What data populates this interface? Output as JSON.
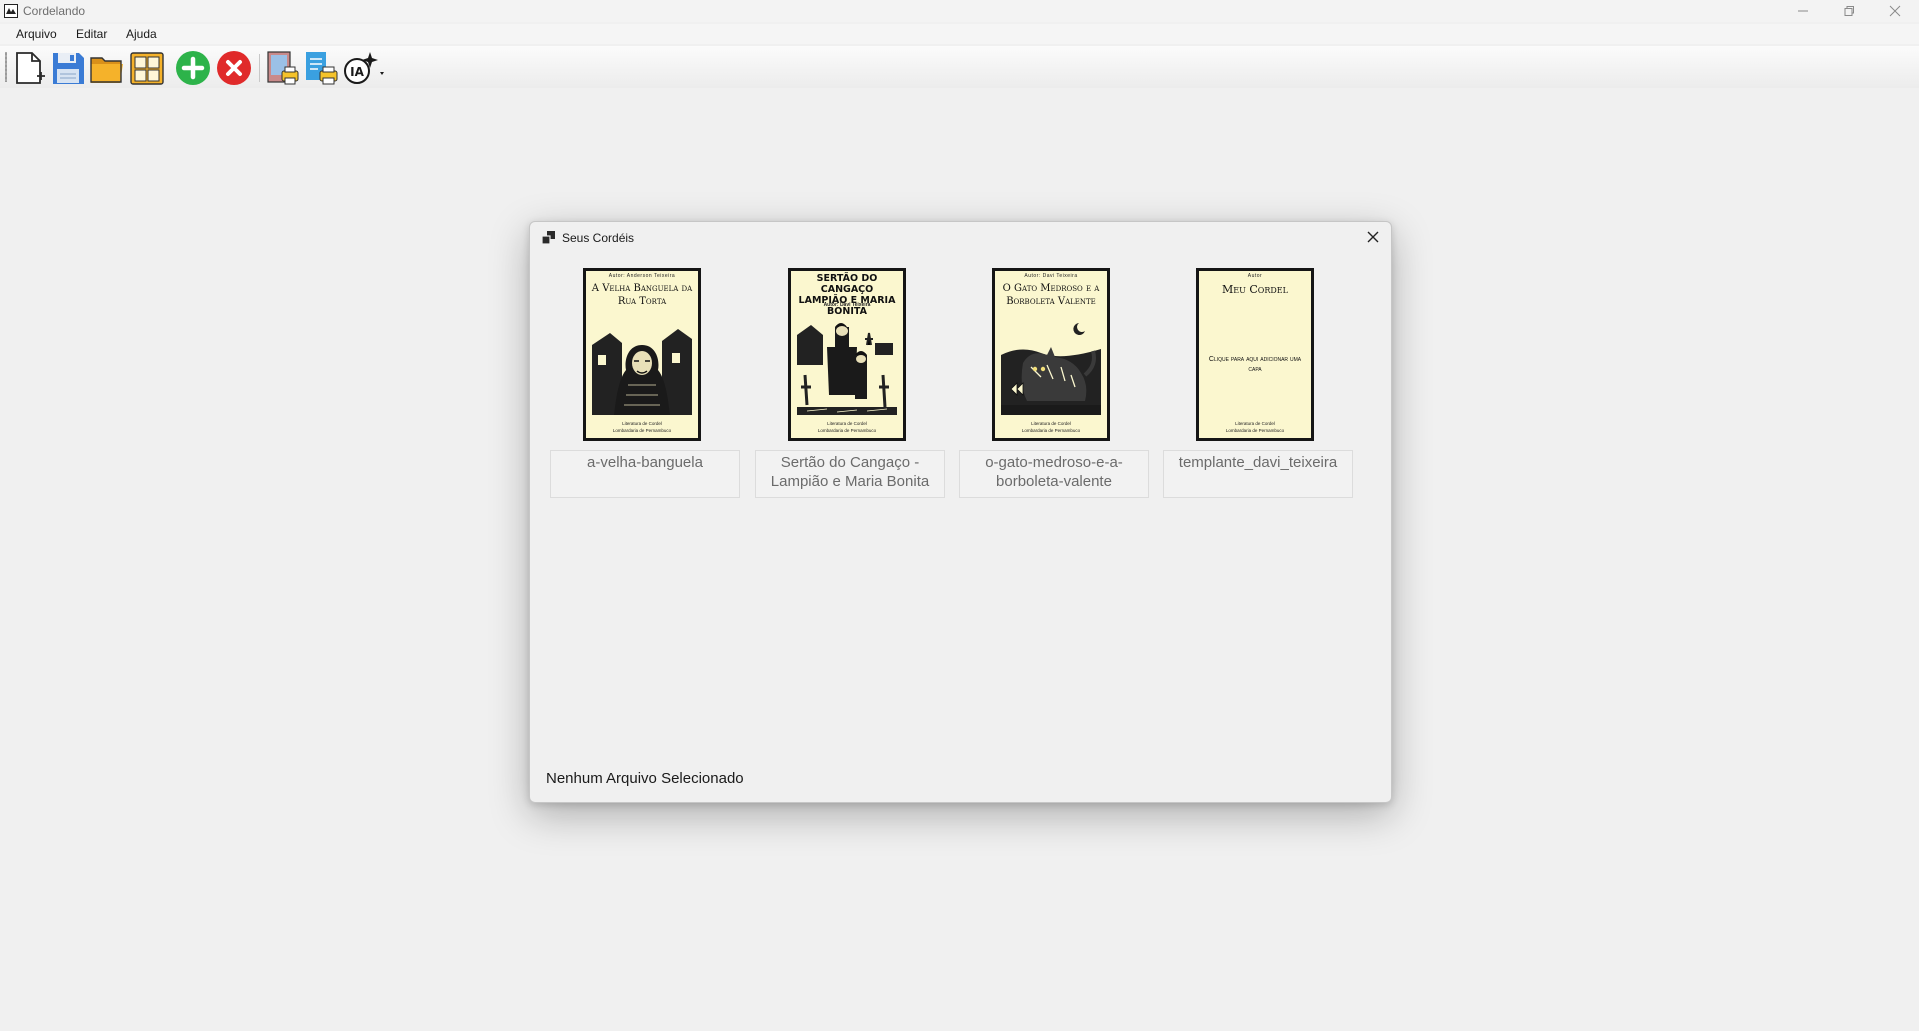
{
  "window": {
    "title": "Cordelando"
  },
  "menu": {
    "items": [
      "Arquivo",
      "Editar",
      "Ajuda"
    ]
  },
  "toolbar": {
    "buttons": [
      {
        "icon": "new-file-icon"
      },
      {
        "icon": "save-icon"
      },
      {
        "icon": "open-folder-icon"
      },
      {
        "icon": "library-icon"
      },
      {
        "icon": "add-icon"
      },
      {
        "icon": "remove-icon"
      },
      {
        "icon": "print-book-icon"
      },
      {
        "icon": "print-document-icon"
      },
      {
        "icon": "ai-assistant-icon"
      }
    ]
  },
  "dialog": {
    "title": "Seus Cordéis",
    "status": "Nenhum Arquivo Selecionado",
    "cordeis": [
      {
        "label": "a-velha-banguela",
        "cover_author": "Autor: Anderson Teixeira",
        "cover_title": "A Velha Banguela da Rua Torta",
        "cover_footer": [
          "Literatura de Cordel",
          "Lombardaria de Pernambuco"
        ]
      },
      {
        "label": "Sertão do Cangaço - Lampião e Maria Bonita",
        "cover_title": "SERTÃO DO CANGAÇO LAMPIÃO E MARIA BONITA",
        "cover_author": "Autor: Davi Teixeira",
        "cover_footer": [
          "Literatura de Cordel",
          "Lombardaria de Pernambuco"
        ]
      },
      {
        "label": "o-gato-medroso-e-a-borboleta-valente",
        "cover_author": "Autor: Davi Teixeira",
        "cover_title": "O Gato Medroso e a Borboleta Valente",
        "cover_footer": [
          "Literatura de Cordel",
          "Lombardaria de Pernambuco"
        ]
      },
      {
        "label": "templante_davi_teixeira",
        "cover_author": "Autor",
        "cover_title": "Meu Cordel",
        "cover_cta": "Clique para aqui adicionar uma capa",
        "cover_footer": [
          "Literatura de Cordel",
          "Lombardaria de Pernambuco"
        ]
      }
    ]
  },
  "colors": {
    "add": "#2db34a",
    "remove": "#e02a2a",
    "folder": "#f0a81a",
    "save": "#3a7bd5",
    "cover_bg": "#fbf7cf"
  }
}
